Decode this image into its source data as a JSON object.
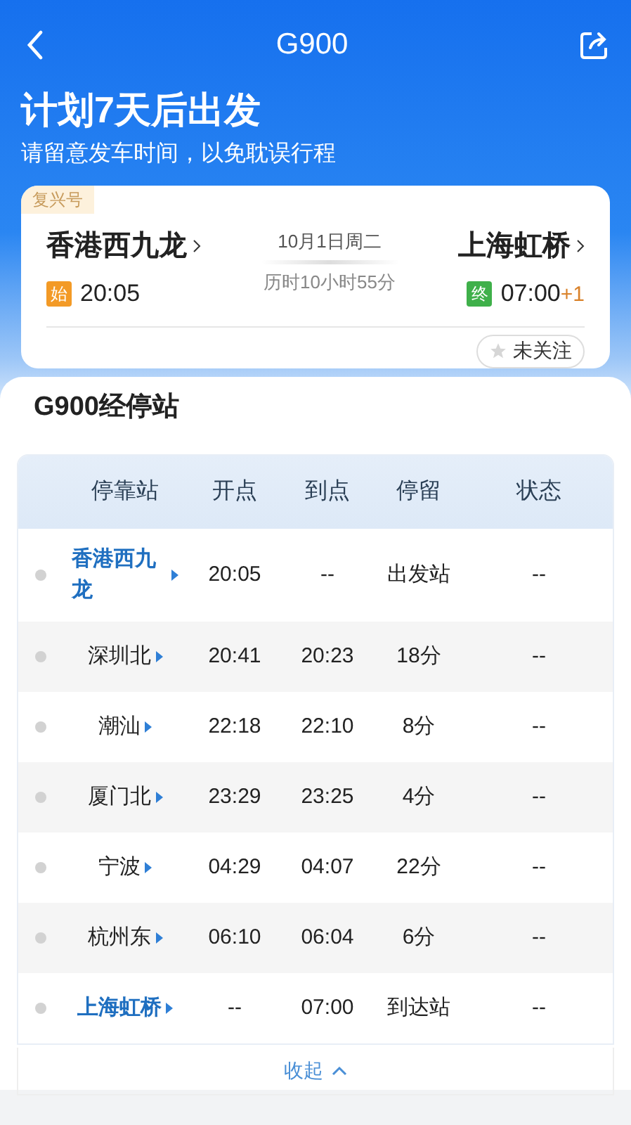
{
  "nav": {
    "title": "G900"
  },
  "banner": {
    "headline": "计划7天后出发",
    "subtitle": "请留意发车时间，以免耽误行程"
  },
  "trip": {
    "train_type": "复兴号",
    "from": {
      "station": "香港西九龙",
      "tag": "始",
      "time": "20:05"
    },
    "date": "10月1日周二",
    "duration": "历时10小时55分",
    "to": {
      "station": "上海虹桥",
      "tag": "终",
      "time": "07:00",
      "day_offset": "+1"
    },
    "follow": {
      "label": "未关注",
      "followed": false
    }
  },
  "stops": {
    "title": "G900经停站",
    "columns": [
      "停靠站",
      "开点",
      "到点",
      "停留",
      "状态"
    ],
    "rows": [
      {
        "kind": "terminal",
        "station": "香港西九龙",
        "depart": "20:05",
        "arrive": "--",
        "stay": "出发站",
        "status": "--"
      },
      {
        "kind": "stop",
        "station": "深圳北",
        "depart": "20:41",
        "arrive": "20:23",
        "stay": "18分",
        "status": "--"
      },
      {
        "kind": "stop",
        "station": "潮汕",
        "depart": "22:18",
        "arrive": "22:10",
        "stay": "8分",
        "status": "--"
      },
      {
        "kind": "stop",
        "station": "厦门北",
        "depart": "23:29",
        "arrive": "23:25",
        "stay": "4分",
        "status": "--"
      },
      {
        "kind": "stop",
        "station": "宁波",
        "depart": "04:29",
        "arrive": "04:07",
        "stay": "22分",
        "status": "--"
      },
      {
        "kind": "stop",
        "station": "杭州东",
        "depart": "06:10",
        "arrive": "06:04",
        "stay": "6分",
        "status": "--"
      },
      {
        "kind": "terminal",
        "station": "上海虹桥",
        "depart": "--",
        "arrive": "07:00",
        "stay": "到达站",
        "status": "--"
      }
    ],
    "collapse": "收起"
  }
}
